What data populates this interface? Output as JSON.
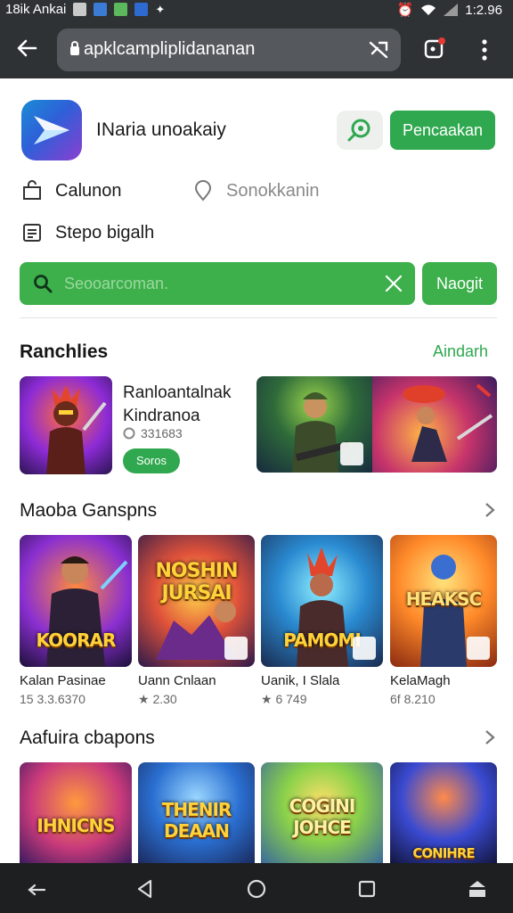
{
  "status_bar": {
    "carrier": "18ik Ankai",
    "time": "1:2.96"
  },
  "browser": {
    "url": "apklcampliplidananan"
  },
  "app": {
    "name": "INaria unoakaiy",
    "install_label": "Pencaakan"
  },
  "meta": {
    "item1": "Calunon",
    "item2": "Sonokkanin",
    "item3": "Stepo bigalh"
  },
  "search": {
    "placeholder": "Seooarcoman.",
    "button_label": "Naogit"
  },
  "featured": {
    "title": "Ranchlies",
    "see_all": "Aindarh",
    "item_title_line1": "Ranloantalnak",
    "item_title_line2": "Kindranoa",
    "item_downloads": "331683",
    "item_button": "Soros"
  },
  "popular": {
    "title": "Maoba Ganspns",
    "items": [
      {
        "caption": "KOORAR",
        "name": "Kalan Pasinae",
        "meta": "15 3.3.6370"
      },
      {
        "caption": "NOSHIN JURSAI",
        "name": "Uann Cnlaan",
        "meta": "2.30"
      },
      {
        "caption": "PAMOMI",
        "name": "Uanik, I Slala",
        "meta": "6 749"
      },
      {
        "caption": "HEAKSC",
        "name": "KelaMagh",
        "meta": "6f 8.210"
      }
    ]
  },
  "action": {
    "title": "Aafuira cbapons",
    "items": [
      {
        "caption": "IHNICNS"
      },
      {
        "caption": "THENIR DEAAN"
      },
      {
        "caption": "COGINI JOHCE"
      },
      {
        "caption": "CONIHRE"
      }
    ]
  },
  "colors": {
    "accent": "#2fa84f",
    "toolbar": "#2f3235"
  }
}
